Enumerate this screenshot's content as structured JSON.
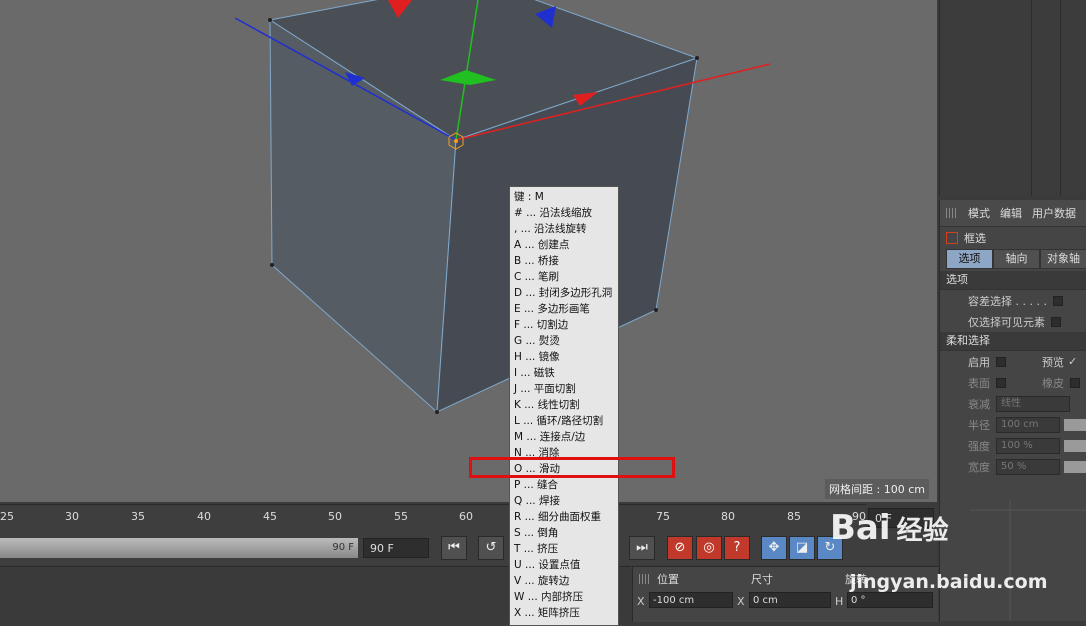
{
  "viewport": {
    "grid_spacing": "网格间距 : 100 cm"
  },
  "attr": {
    "menu": [
      "模式",
      "编辑",
      "用户数据"
    ],
    "mode_label": "框选",
    "tabs": [
      "选项",
      "轴向",
      "对象轴"
    ],
    "section_options": "选项",
    "tolerance_select": "容差选择 . . . . .",
    "visible_only": "仅选择可见元素",
    "section_soft": "柔和选择",
    "enable": "启用",
    "preview": "预览",
    "surface": "表面",
    "rubber": "橡皮",
    "falloff": "衰减",
    "falloff_value": "线性",
    "radius": "半径",
    "radius_value": "100 cm",
    "strength": "强度",
    "strength_value": "100 %",
    "width": "宽度",
    "width_value": "50 %"
  },
  "timeline": {
    "ticks": [
      "25",
      "30",
      "35",
      "40",
      "45",
      "50",
      "55",
      "60",
      "75",
      "80",
      "85",
      "90"
    ],
    "current_frame": "0 F",
    "slider_value": "90 F",
    "end_frame": "90 F"
  },
  "coord": {
    "position": "位置",
    "size": "尺寸",
    "rotation": "旋转",
    "x_label": "X",
    "x_value": "-100 cm",
    "sx_label": "X",
    "sx_value": "0 cm",
    "h_label": "H",
    "h_value": "0 °"
  },
  "popup": {
    "title": "键 :   M",
    "items": [
      "# ... 沿法线缩放",
      ", ... 沿法线旋转",
      "A ... 创建点",
      "B ... 桥接",
      "C ... 笔刷",
      "D ... 封闭多边形孔洞",
      "E ... 多边形画笔",
      "F ... 切割边",
      "G ... 熨烫",
      "H ... 镜像",
      "I ... 磁铁",
      "J ... 平面切割",
      "K ... 线性切割",
      "L ... 循环/路径切割",
      "M ... 连接点/边",
      "N ... 消除",
      "O ... 滑动",
      "P ... 缝合",
      "Q ... 焊接",
      "R ... 细分曲面权重",
      "S ... 倒角",
      "T ... 挤压",
      "U ... 设置点值",
      "V ... 旋转边",
      "W ... 内部挤压",
      "X ... 矩阵挤压"
    ]
  },
  "watermark": {
    "brand": "Bai",
    "brand2": "经验",
    "url": "jingyan.baidu.com"
  },
  "colors": {
    "highlight": "#e01010",
    "active_tab": "#8ea6c6",
    "axis_x": "#e02020",
    "axis_y": "#20c020",
    "axis_z": "#2030d0"
  }
}
